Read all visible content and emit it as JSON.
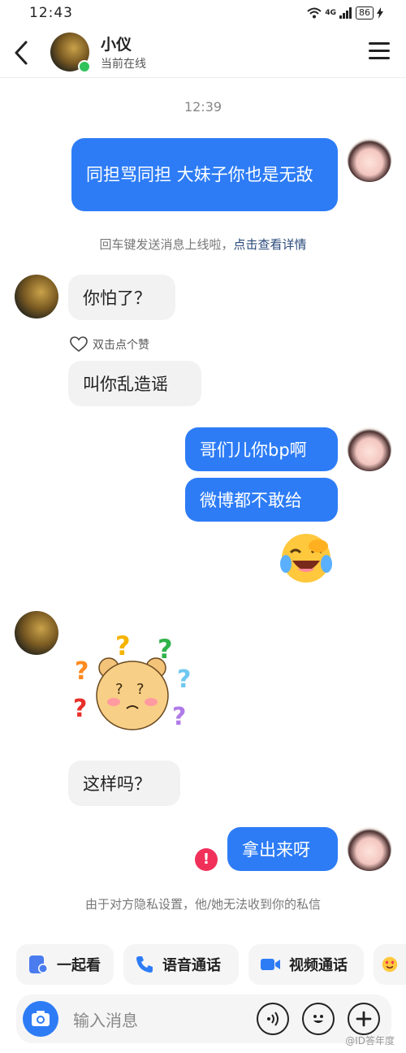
{
  "status_bar": {
    "time": "12:43",
    "network": "4G",
    "battery": "86"
  },
  "header": {
    "contact_name": "小仪",
    "contact_status": "当前在线"
  },
  "messages": {
    "timestamp": "12:39",
    "m1": "同担骂同担 大妹子你也是无敌",
    "notice": {
      "text": "回车键发送消息上线啦，",
      "link": "点击查看详情"
    },
    "m2": "你怕了？",
    "like_label": "双击点个赞",
    "m3": "叫你乱造谣",
    "m4": "哥们儿你bp啊",
    "m5": "微博都不敢给",
    "m6": "这样吗？",
    "m7": "拿出来呀",
    "privacy_notice": "由于对方隐私设置，他/她无法收到你的私信"
  },
  "quick_actions": [
    {
      "label": "一起看",
      "icon": "watch-together-icon"
    },
    {
      "label": "语音通话",
      "icon": "phone-icon"
    },
    {
      "label": "视频通话",
      "icon": "video-icon"
    }
  ],
  "input": {
    "placeholder": "输入消息"
  },
  "watermark": "@ID答年度"
}
